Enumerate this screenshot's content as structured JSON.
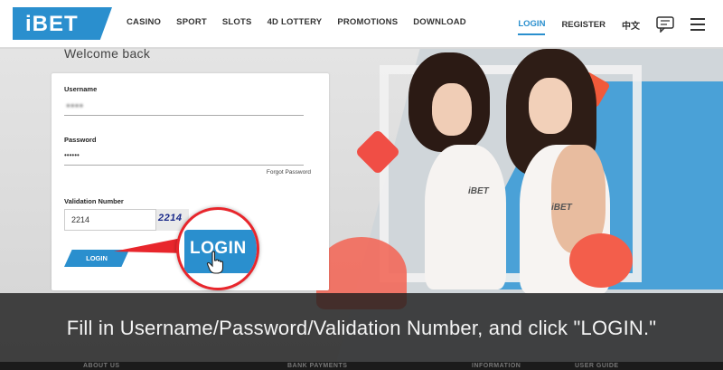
{
  "header": {
    "logo_text": "iBET",
    "nav": [
      "CASINO",
      "SPORT",
      "SLOTS",
      "4D LOTTERY",
      "PROMOTIONS",
      "DOWNLOAD"
    ],
    "login": "LOGIN",
    "register": "REGISTER",
    "language": "中文",
    "chat_icon": "chat-icon",
    "menu_icon": "hamburger-menu-icon"
  },
  "login_form": {
    "welcome": "Welcome back",
    "username_label": "Username",
    "username_value": "●●●●",
    "password_label": "Password",
    "password_value": "••••••",
    "forgot_password": "Forgot Password",
    "validation_label": "Validation Number",
    "validation_value": "2214",
    "captcha_text": "2214",
    "login_button": "LOGIN"
  },
  "callout": {
    "button_label": "LOGIN"
  },
  "hero": {
    "tattoo_1": "iBET",
    "tattoo_2": "iBET"
  },
  "caption": "Fill in Username/Password/Validation Number,  and click \"LOGIN.\"",
  "footer": {
    "items": [
      "ABOUT US",
      "BANK PAYMENTS",
      "INFORMATION",
      "USER GUIDE"
    ]
  },
  "colors": {
    "brand_blue": "#2a8fce",
    "callout_red": "#e8262c"
  }
}
